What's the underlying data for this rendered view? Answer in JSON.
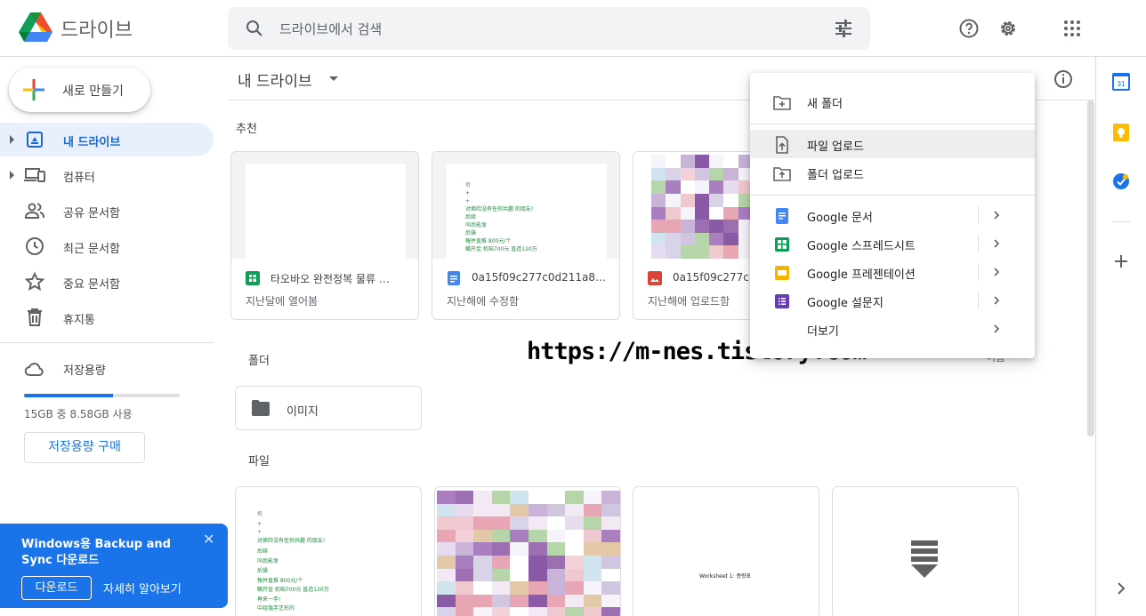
{
  "app": {
    "title": "드라이브"
  },
  "search": {
    "placeholder": "드라이브에서 검색"
  },
  "sidebar": {
    "new_label": "새로 만들기",
    "items": [
      {
        "label": "내 드라이브",
        "icon": "my-drive-icon",
        "active": true
      },
      {
        "label": "컴퓨터",
        "icon": "computers-icon"
      },
      {
        "label": "공유 문서함",
        "icon": "shared-icon"
      },
      {
        "label": "최근 문서함",
        "icon": "clock-icon"
      },
      {
        "label": "중요 문서함",
        "icon": "star-icon"
      },
      {
        "label": "휴지통",
        "icon": "trash-icon"
      }
    ],
    "storage": {
      "label": "저장용량",
      "usage_text": "15GB 중 8.58GB 사용",
      "used_fraction": 0.572,
      "buy_label": "저장용량 구매"
    }
  },
  "toast": {
    "title": "Windows용 Backup and Sync 다운로드",
    "download_label": "다운로드",
    "learn_more_label": "자세히 알아보기",
    "close_glyph": "✕"
  },
  "main": {
    "title": "내 드라이브",
    "suggested_label": "추천",
    "folders_label": "폴더",
    "files_label": "파일",
    "folders_sort_fragment": "이름",
    "suggested": [
      {
        "name": "타오바오 완전정복 물류 …",
        "meta": "지난달에 열어봄",
        "type": "sheets"
      },
      {
        "name": "0a15f09c277c0d211a8…",
        "meta": "지난해에 수정함",
        "type": "docs"
      },
      {
        "name": "0a15f09c277c0",
        "meta": "지난해에 업로드함",
        "type": "image"
      }
    ],
    "folders": [
      {
        "name": "이미지"
      }
    ],
    "thumb_text": {
      "doc_lines": [
        "뢰",
        "+",
        "+",
        "对换险没有任何共趣 的朋友!",
        "后续",
        "叫后能发",
        "后操",
        "報并直推 800元/个",
        "職开金 机咱700元 直造120万"
      ],
      "file_lines": [
        "뢰",
        "+",
        "+",
        "对换险没有任何共趣 的朋友!",
        "后续",
        "叫后能发",
        "后操",
        "報并直推 800元/个",
        "職开金 机咱700元 直造120万",
        "再来一手!",
        "中组塩手艺形的"
      ],
      "worksheet_label": "Worksheet 1: 종량표"
    }
  },
  "menu": {
    "items": [
      {
        "label": "새 폴더",
        "icon": "new-folder-icon"
      },
      {
        "label": "파일 업로드",
        "icon": "file-upload-icon",
        "hover": true
      },
      {
        "label": "폴더 업로드",
        "icon": "folder-upload-icon"
      },
      {
        "label": "Google 문서",
        "icon": "google-docs-icon",
        "submenu": true
      },
      {
        "label": "Google 스프레드시트",
        "icon": "google-sheets-icon",
        "submenu": true
      },
      {
        "label": "Google 프레젠테이션",
        "icon": "google-slides-icon",
        "submenu": true
      },
      {
        "label": "Google 설문지",
        "icon": "google-forms-icon",
        "submenu": true
      },
      {
        "label": "더보기",
        "icon": "",
        "submenu": true
      }
    ]
  },
  "watermark": "https://m-nes.tistory.com",
  "side_panel": {
    "calendar_day": "31"
  },
  "colors": {
    "blue": "#1a73e8",
    "green": "#0f9d58",
    "yellow": "#f4b400",
    "red": "#db4437",
    "purple": "#673ab7",
    "active_bg": "#e8f0fe"
  }
}
